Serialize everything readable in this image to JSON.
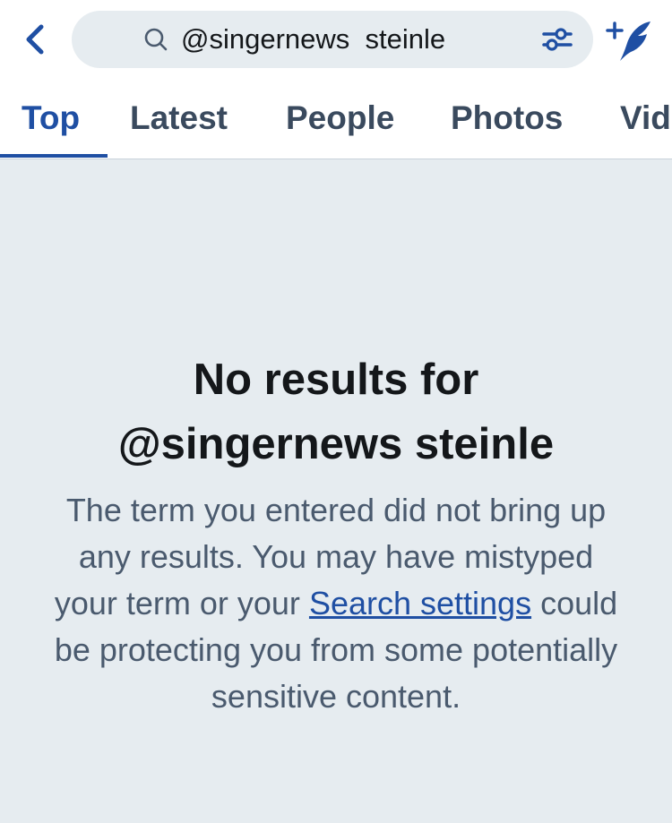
{
  "header": {
    "search_query": "@singernews  steinle",
    "icons": {
      "back": "chevron-left-icon",
      "search": "search-icon",
      "filter": "filter-sliders-icon",
      "compose": "compose-tweet-icon"
    },
    "accent_color": "#1f4fa3"
  },
  "tabs": [
    {
      "label": "Top",
      "active": true
    },
    {
      "label": "Latest",
      "active": false
    },
    {
      "label": "People",
      "active": false
    },
    {
      "label": "Photos",
      "active": false
    },
    {
      "label": "Videos",
      "active": false
    }
  ],
  "empty_state": {
    "title": "No results for\n@singernews  steinle",
    "body_before": "The term you entered did not bring up any results. You may have mistyped your term or your ",
    "link_text": "Search settings",
    "body_after": " could be protecting you from some potentially sensitive content."
  }
}
